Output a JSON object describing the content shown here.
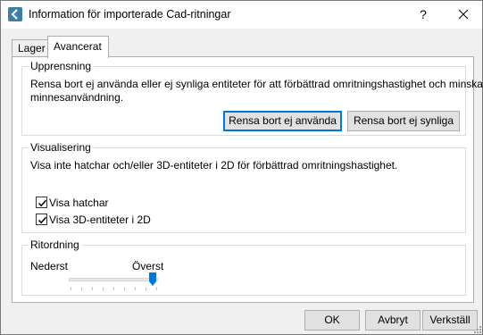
{
  "window": {
    "title": "Information för importerade Cad-ritningar",
    "help_label": "?"
  },
  "tabs": [
    {
      "label": "Lager",
      "active": false
    },
    {
      "label": "Avancerat",
      "active": true
    }
  ],
  "groups": {
    "uppresning": {
      "title": "Upprensning",
      "desc_line1": "Rensa bort ej använda eller ej synliga entiteter för att förbättrad omritningshastighet och minskad",
      "desc_line2": "minnesanvändning.",
      "btn_unused": "Rensa bort ej använda",
      "btn_hidden": "Rensa bort ej synliga"
    },
    "visualisering": {
      "title": "Visualisering",
      "desc": "Visa inte hatchar och/eller 3D-entiteter i 2D för förbättrad omritningshastighet.",
      "check_hatch": {
        "label": "Visa hatchar",
        "checked": true
      },
      "check_3d": {
        "label": "Visa 3D-entiteter i 2D",
        "checked": true
      }
    },
    "ritordning": {
      "title": "Ritordning",
      "left_label": "Nederst",
      "right_label": "Överst",
      "level": 1.0
    }
  },
  "footer": {
    "ok": "OK",
    "cancel": "Avbryt",
    "apply": "Verkställ"
  },
  "colors": {
    "accent": "#0078d7",
    "window_bg": "#f0f0f0",
    "button_bg": "#e1e1e1"
  }
}
